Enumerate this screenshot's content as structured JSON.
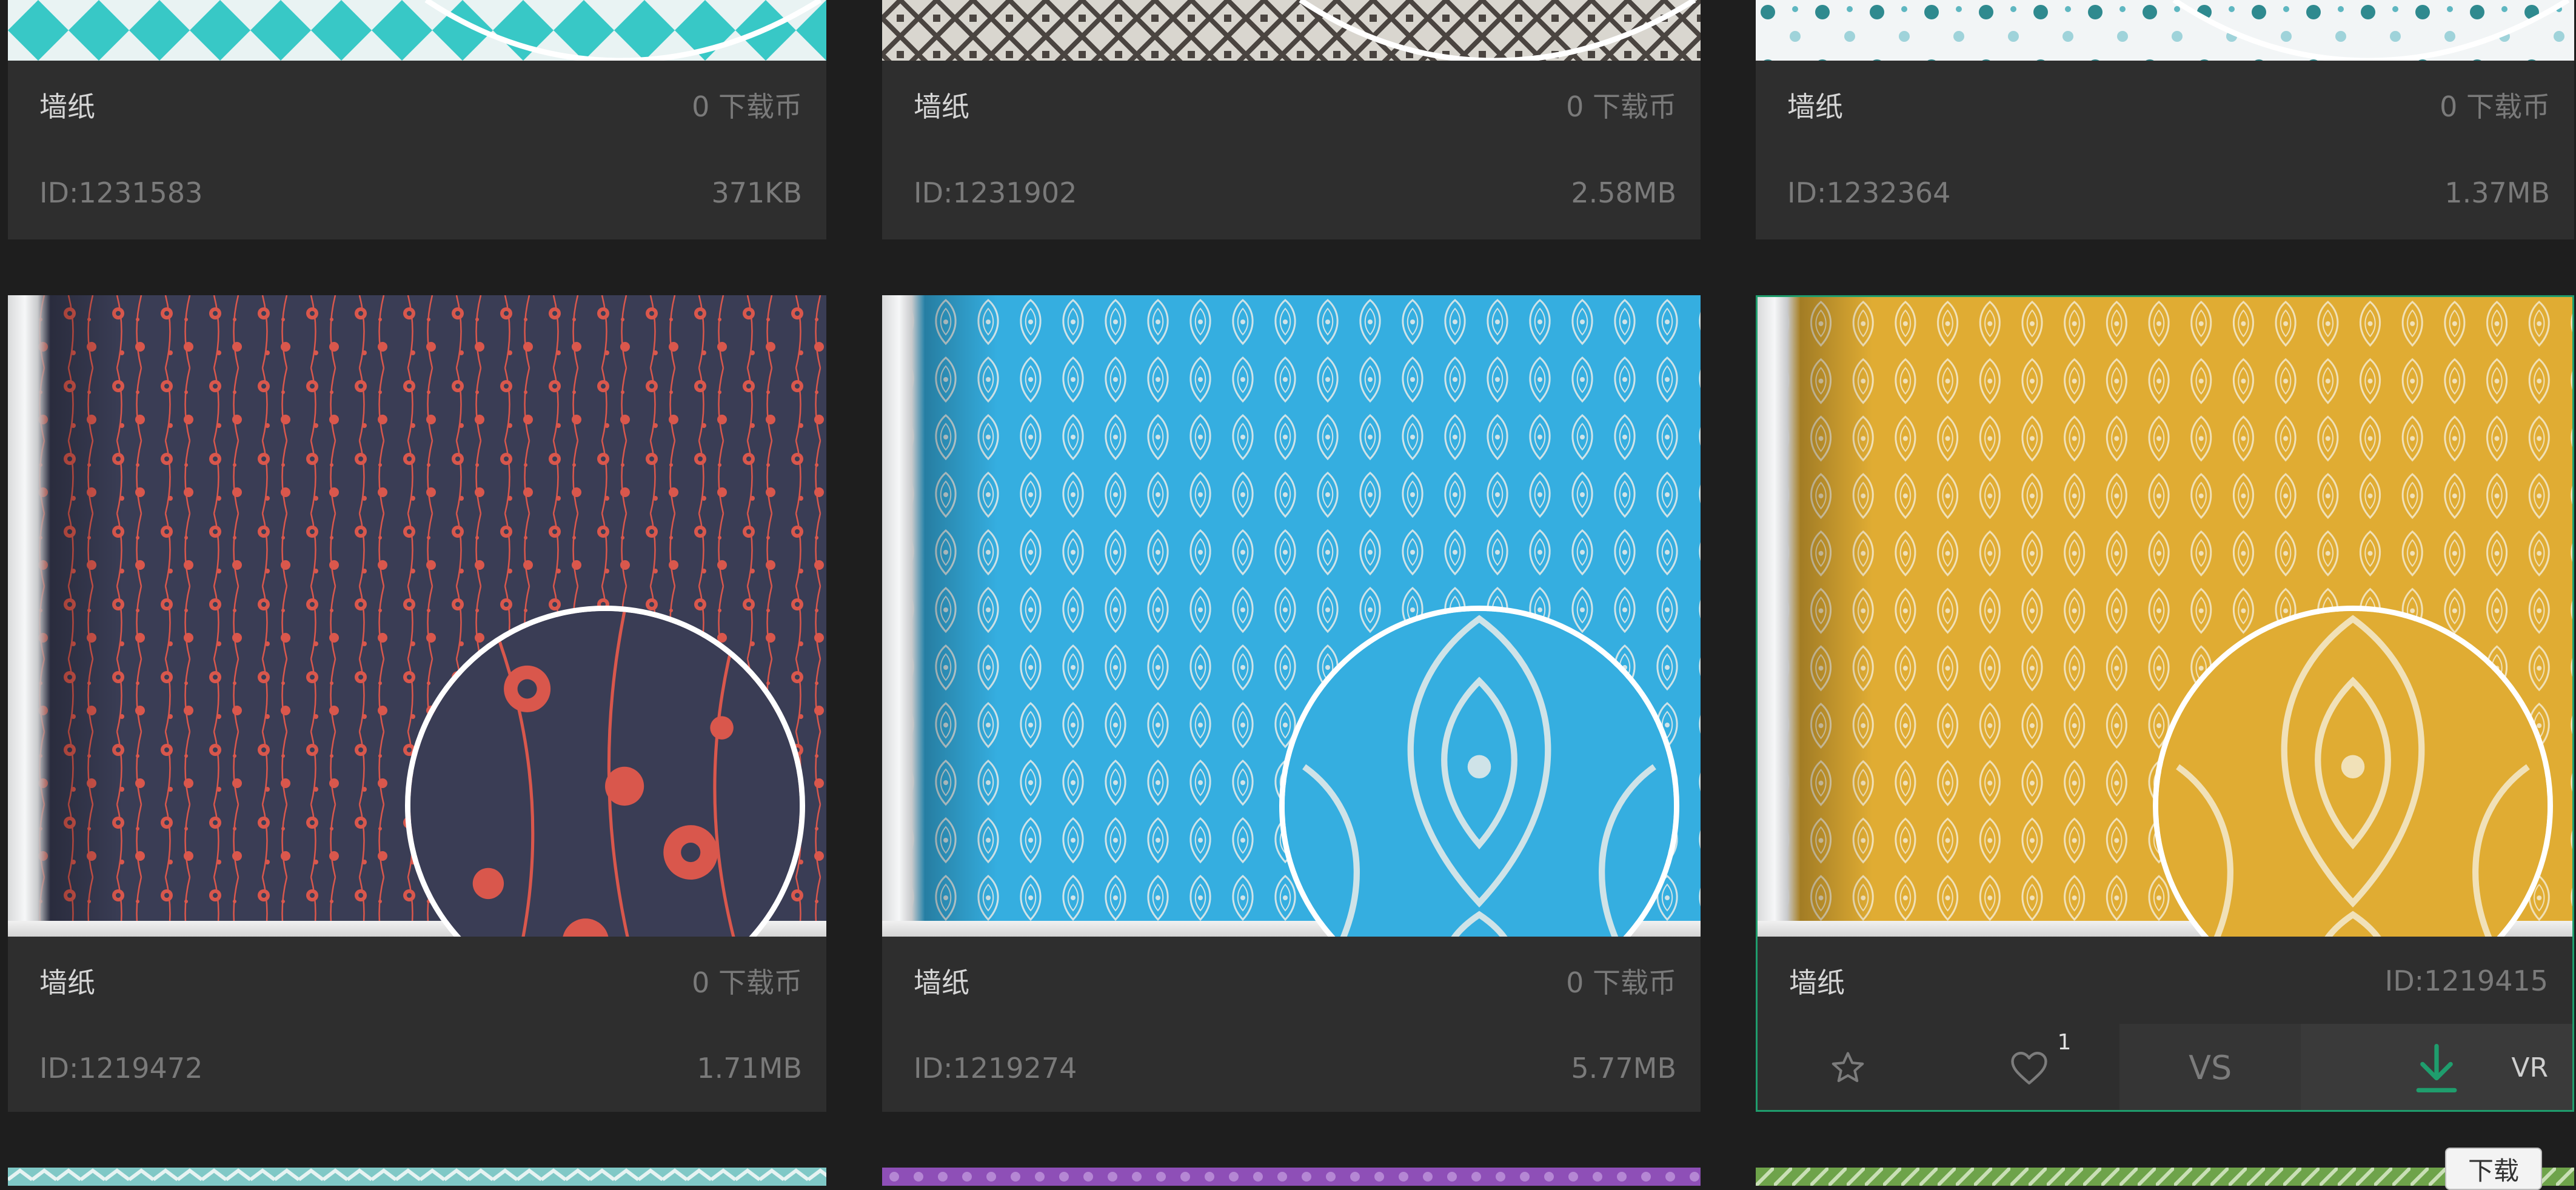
{
  "cards": [
    {
      "title": "墙纸",
      "coins": "0 下载币",
      "id": "ID:1231583",
      "size": "371KB",
      "pattern": "diamond-teal"
    },
    {
      "title": "墙纸",
      "coins": "0 下载币",
      "id": "ID:1231902",
      "size": "2.58MB",
      "pattern": "geometric-grey"
    },
    {
      "title": "墙纸",
      "coins": "0 下载币",
      "id": "ID:1232364",
      "size": "1.37MB",
      "pattern": "floral-white"
    },
    {
      "title": "墙纸",
      "coins": "0 下载币",
      "id": "ID:1219472",
      "size": "1.71MB",
      "pattern": "hearts-navy",
      "color": "#3a3d55",
      "accent": "#d9574c"
    },
    {
      "title": "墙纸",
      "coins": "0 下载币",
      "id": "ID:1219274",
      "size": "5.77MB",
      "pattern": "damask-blue",
      "color": "#35aee0",
      "accent": "#cfe3e8"
    },
    {
      "title": "墙纸",
      "id": "ID:1219415",
      "pattern": "damask-gold",
      "color": "#e0ac33",
      "accent": "#f1e1b8",
      "actions": {
        "favorite_icon": "star-outline-icon",
        "like_icon": "heart-outline-icon",
        "like_count": "1",
        "compare": "VS",
        "download_icon": "download-arrow-icon",
        "vr": "VR"
      }
    }
  ],
  "tooltip": "下载",
  "colors": {
    "selected_border": "#1f9d6d",
    "download_icon": "#1f9d6d"
  }
}
